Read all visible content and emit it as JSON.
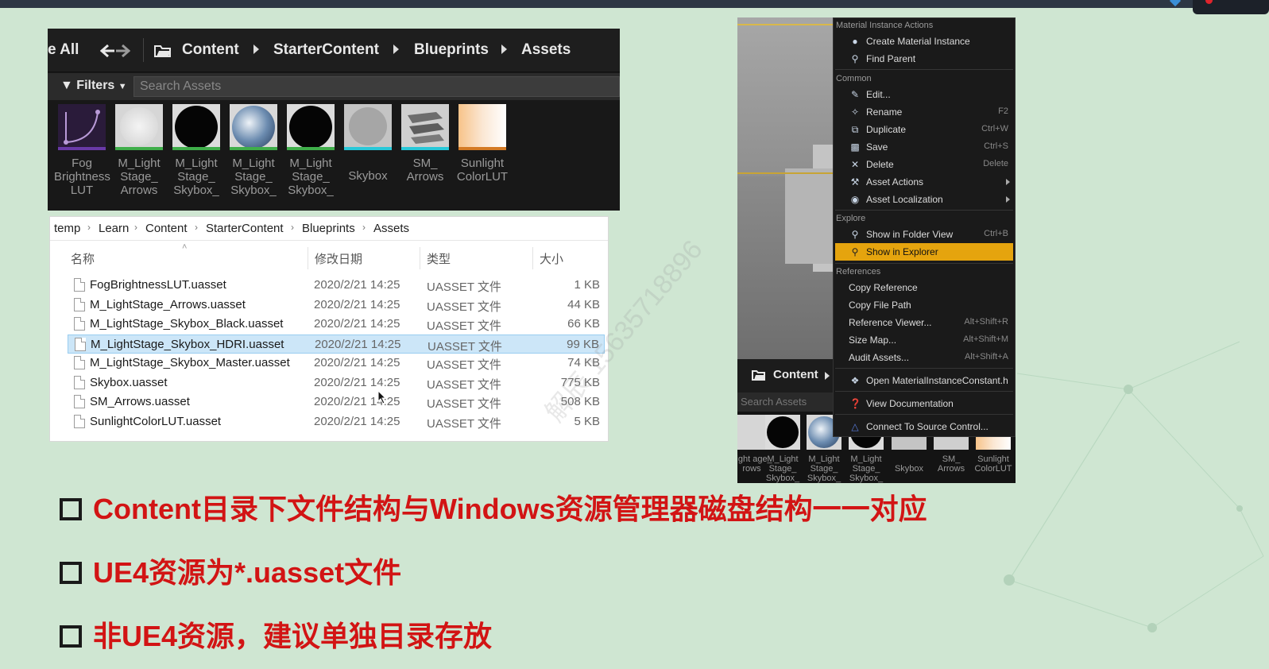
{
  "ue_browser": {
    "path": [
      "e All",
      "Content",
      "StarterContent",
      "Blueprints",
      "Assets"
    ],
    "filters_label": "Filters",
    "search_placeholder": "Search Assets",
    "tiles": [
      {
        "label": "Fog Brightness LUT",
        "icon": "fog-lut-thumbnail"
      },
      {
        "label": "M_Light Stage_ Arrows",
        "icon": "light-sphere-thumbnail"
      },
      {
        "label": "M_Light Stage_ Skybox_",
        "icon": "black-sphere-thumbnail"
      },
      {
        "label": "M_Light Stage_ Skybox_",
        "icon": "hdri-sphere-thumbnail"
      },
      {
        "label": "M_Light Stage_ Skybox_",
        "icon": "black-sphere-thumbnail"
      },
      {
        "label": "Skybox",
        "icon": "gray-sphere-thumbnail"
      },
      {
        "label": "SM_ Arrows",
        "icon": "arrows-mesh-thumbnail"
      },
      {
        "label": "Sunlight ColorLUT",
        "icon": "gradient-thumbnail"
      }
    ]
  },
  "explorer": {
    "breadcrumb": [
      "temp",
      "Learn",
      "Content",
      "StarterContent",
      "Blueprints",
      "Assets"
    ],
    "columns": {
      "name": "名称",
      "date": "修改日期",
      "type": "类型",
      "size": "大小"
    },
    "files": [
      {
        "name": "FogBrightnessLUT.uasset",
        "date": "2020/2/21 14:25",
        "type": "UASSET 文件",
        "size": "1 KB"
      },
      {
        "name": "M_LightStage_Arrows.uasset",
        "date": "2020/2/21 14:25",
        "type": "UASSET 文件",
        "size": "44 KB"
      },
      {
        "name": "M_LightStage_Skybox_Black.uasset",
        "date": "2020/2/21 14:25",
        "type": "UASSET 文件",
        "size": "66 KB"
      },
      {
        "name": "M_LightStage_Skybox_HDRI.uasset",
        "date": "2020/2/21 14:25",
        "type": "UASSET 文件",
        "size": "99 KB",
        "selected": true
      },
      {
        "name": "M_LightStage_Skybox_Master.uasset",
        "date": "2020/2/21 14:25",
        "type": "UASSET 文件",
        "size": "74 KB"
      },
      {
        "name": "Skybox.uasset",
        "date": "2020/2/21 14:25",
        "type": "UASSET 文件",
        "size": "775 KB"
      },
      {
        "name": "SM_Arrows.uasset",
        "date": "2020/2/21 14:25",
        "type": "UASSET 文件",
        "size": "508 KB"
      },
      {
        "name": "SunlightColorLUT.uasset",
        "date": "2020/2/21 14:25",
        "type": "UASSET 文件",
        "size": "5 KB"
      }
    ]
  },
  "context_menu": {
    "sections": {
      "material": "Material Instance Actions",
      "common": "Common",
      "explore": "Explore",
      "references": "References"
    },
    "items": {
      "create_mi": {
        "label": "Create Material Instance",
        "icon": "material-icon"
      },
      "find_parent": {
        "label": "Find Parent",
        "icon": "search-icon"
      },
      "edit": {
        "label": "Edit...",
        "icon": "pencil-icon"
      },
      "rename": {
        "label": "Rename",
        "key": "F2",
        "icon": "rename-icon"
      },
      "duplicate": {
        "label": "Duplicate",
        "key": "Ctrl+W",
        "icon": "duplicate-icon"
      },
      "save": {
        "label": "Save",
        "key": "Ctrl+S",
        "icon": "save-icon"
      },
      "delete": {
        "label": "Delete",
        "key": "Delete",
        "icon": "close-icon"
      },
      "asset_actions": {
        "label": "Asset Actions",
        "icon": "wrench-icon"
      },
      "asset_localization": {
        "label": "Asset Localization",
        "icon": "globe-icon"
      },
      "show_folder": {
        "label": "Show in Folder View",
        "key": "Ctrl+B",
        "icon": "search-icon"
      },
      "show_explorer": {
        "label": "Show in Explorer",
        "icon": "search-icon"
      },
      "copy_ref": {
        "label": "Copy Reference"
      },
      "copy_path": {
        "label": "Copy File Path"
      },
      "ref_viewer": {
        "label": "Reference Viewer...",
        "key": "Alt+Shift+R"
      },
      "size_map": {
        "label": "Size Map...",
        "key": "Alt+Shift+M"
      },
      "audit": {
        "label": "Audit Assets...",
        "key": "Alt+Shift+A"
      },
      "open_h": {
        "label": "Open MaterialInstanceConstant.h",
        "icon": "code-icon"
      },
      "view_docs": {
        "label": "View Documentation",
        "icon": "help-icon"
      },
      "source_control": {
        "label": "Connect To Source Control...",
        "icon": "source-control-icon"
      }
    }
  },
  "bg_browser": {
    "content_label": "Content",
    "search_placeholder": "Search Assets",
    "tiles": [
      {
        "label": "Light age_ rows"
      },
      {
        "label": "M_Light Stage_ Skybox_"
      },
      {
        "label": "M_Light Stage_ Skybox_"
      },
      {
        "label": "M_Light Stage_ Skybox_"
      },
      {
        "label": "Skybox"
      },
      {
        "label": "SM_ Arrows"
      },
      {
        "label": "Sunlight ColorLUT"
      }
    ]
  },
  "watermark": "解辰 15635718896",
  "bullets": [
    "Content目录下文件结构与Windows资源管理器磁盘结构一一对应",
    "UE4资源为*.uasset文件",
    "非UE4资源，建议单独目录存放"
  ],
  "colors": {
    "accent": "#d21414",
    "highlight": "#e5a40e",
    "selection": "#cce6f8",
    "background": "#cfe6d2"
  }
}
